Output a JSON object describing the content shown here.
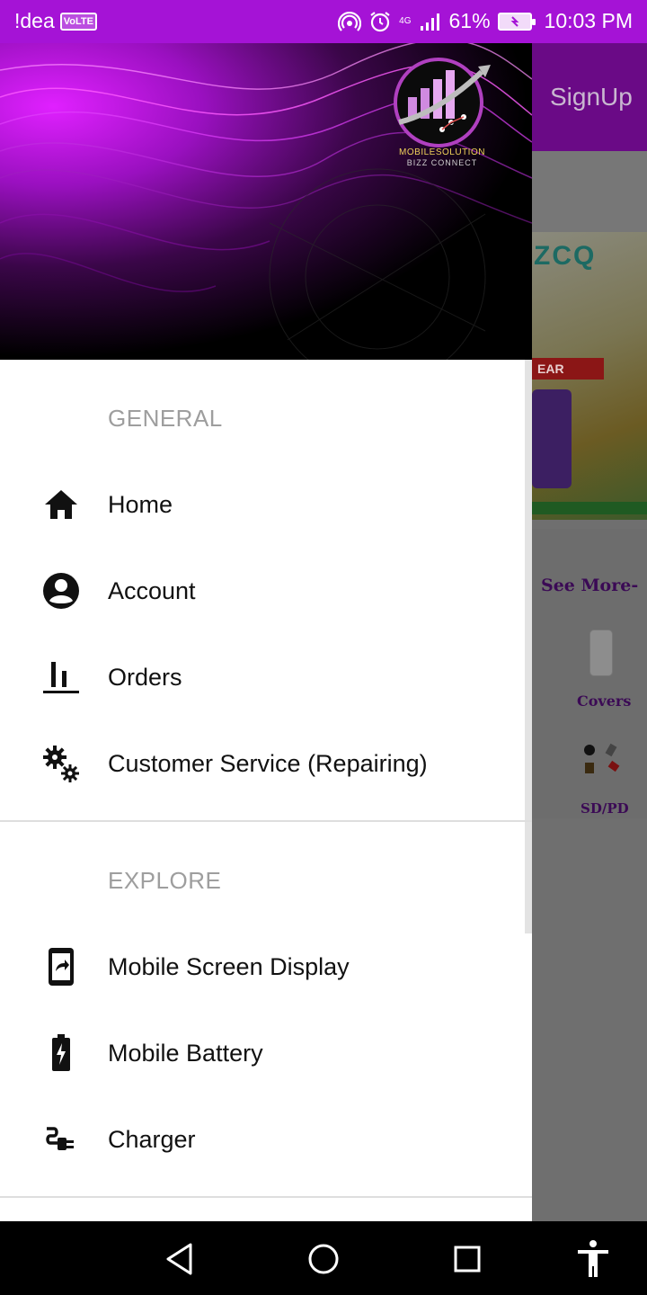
{
  "status_bar": {
    "carrier": "!dea",
    "volte": "VoLTE",
    "network": "4G",
    "battery_pct": "61%",
    "time": "10:03 PM",
    "bg_color": "#a513d6"
  },
  "background_app": {
    "signup_label": "SignUp",
    "banner_brand": "ZCQ",
    "banner_warranty": "EAR\nARRANTY",
    "see_more_label": "See More-",
    "covers_label": "Covers",
    "sd_label": "SD/PD"
  },
  "drawer": {
    "logo": {
      "line1": "MOBILESOLUTION",
      "line2": "BIZZ CONNECT"
    },
    "sections": [
      {
        "title": "GENERAL",
        "items": [
          {
            "label": "Home",
            "icon": "home-icon"
          },
          {
            "label": "Account",
            "icon": "account-circle-icon"
          },
          {
            "label": "Orders",
            "icon": "bar-chart-icon"
          },
          {
            "label": "Customer Service (Repairing)",
            "icon": "gears-icon"
          }
        ]
      },
      {
        "title": "EXPLORE",
        "items": [
          {
            "label": "Mobile Screen Display",
            "icon": "phone-screen-share-icon"
          },
          {
            "label": "Mobile Battery",
            "icon": "battery-charging-icon"
          },
          {
            "label": "Charger",
            "icon": "power-plug-icon"
          }
        ]
      }
    ]
  },
  "nav_bar": {
    "buttons": [
      "back-icon",
      "home-circle-icon",
      "recents-square-icon",
      "accessibility-icon"
    ]
  }
}
